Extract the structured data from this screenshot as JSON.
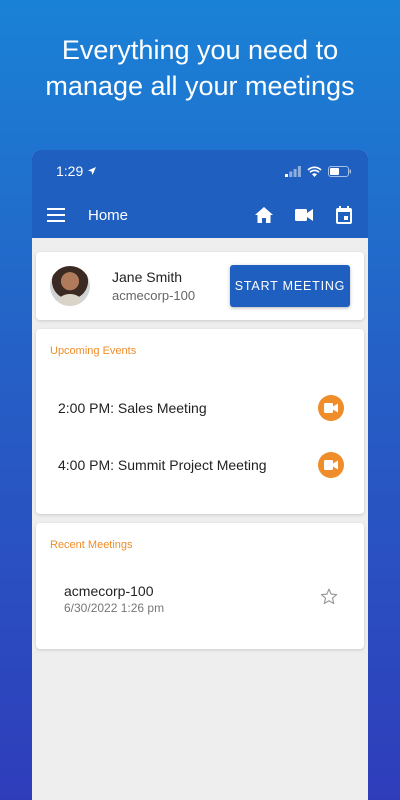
{
  "headline": {
    "line1": "Everything you need to",
    "line2": "manage all your meetings"
  },
  "statusbar": {
    "time": "1:29"
  },
  "appbar": {
    "title": "Home"
  },
  "profile": {
    "name": "Jane Smith",
    "room": "acmecorp-100",
    "start_button": "START MEETING"
  },
  "upcoming": {
    "title": "Upcoming Events",
    "events": [
      {
        "label": "2:00 PM: Sales Meeting"
      },
      {
        "label": "4:00 PM: Summit Project Meeting"
      }
    ]
  },
  "recent": {
    "title": "Recent Meetings",
    "items": [
      {
        "name": "acmecorp-100",
        "date": "6/30/2022 1:26 pm",
        "favorite": false
      }
    ]
  },
  "colors": {
    "primary": "#1f5fbf",
    "accent": "#ef8d2a"
  }
}
